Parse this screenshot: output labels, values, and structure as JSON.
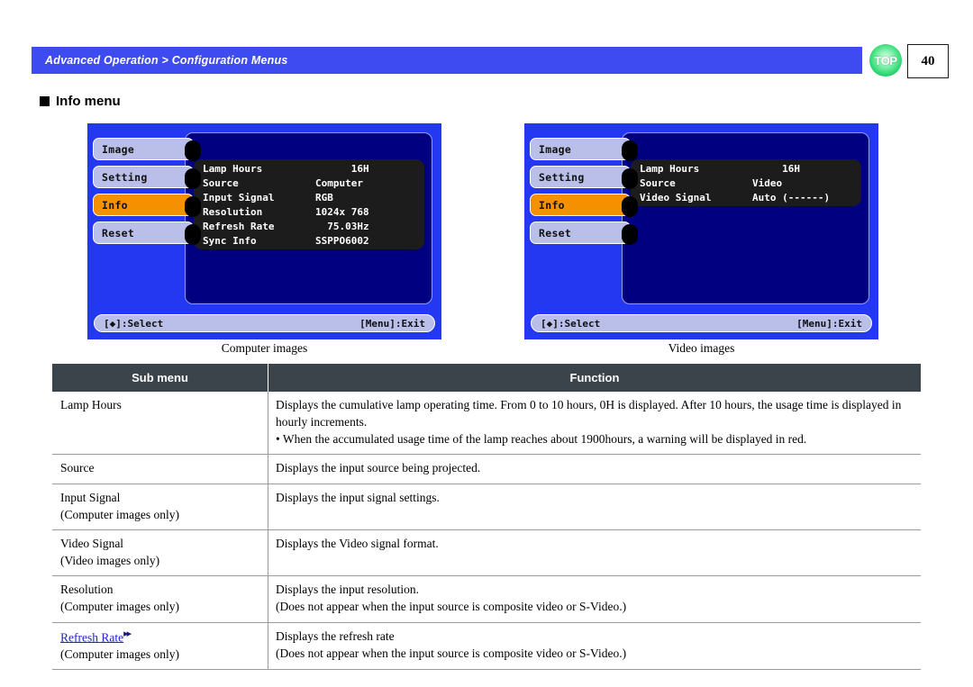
{
  "header": {
    "breadcrumb": "Advanced Operation > Configuration Menus",
    "top_badge_label": "TOP",
    "page_number": "40",
    "bar_color": "#3d4bf0",
    "badge_color": "#3ee07e"
  },
  "section": {
    "heading": "Info menu"
  },
  "osd_screens": [
    {
      "caption": "Computer images",
      "tabs": [
        {
          "label": "Image",
          "selected": false
        },
        {
          "label": "Setting",
          "selected": false
        },
        {
          "label": "Info",
          "selected": true
        },
        {
          "label": "Reset",
          "selected": false
        }
      ],
      "rows": [
        {
          "label": "Lamp Hours",
          "value": "      16H"
        },
        {
          "label": "Source",
          "value": "Computer"
        },
        {
          "label": "Input Signal",
          "value": "RGB"
        },
        {
          "label": "Resolution",
          "value": "1024x 768"
        },
        {
          "label": "Refresh Rate",
          "value": "  75.03Hz"
        },
        {
          "label": "Sync Info",
          "value": "SSPPO6002"
        }
      ],
      "footer_left": "[◆]:Select",
      "footer_right": "[Menu]:Exit"
    },
    {
      "caption": "Video images",
      "tabs": [
        {
          "label": "Image",
          "selected": false
        },
        {
          "label": "Setting",
          "selected": false
        },
        {
          "label": "Info",
          "selected": true
        },
        {
          "label": "Reset",
          "selected": false
        }
      ],
      "rows": [
        {
          "label": "Lamp Hours",
          "value": "     16H"
        },
        {
          "label": "Source",
          "value": "Video"
        },
        {
          "label": "Video Signal",
          "value": "Auto (------)"
        }
      ],
      "footer_left": "[◆]:Select",
      "footer_right": "[Menu]:Exit"
    }
  ],
  "table": {
    "headers": {
      "sub_menu": "Sub menu",
      "function": "Function"
    },
    "rows": [
      {
        "sub_menu": "Lamp Hours",
        "sub_note": "",
        "function_lines": [
          "Displays the cumulative lamp operating time. From 0 to 10 hours, 0H is displayed. After 10 hours, the usage time is displayed in hourly increments.",
          "• When the accumulated usage time of the lamp reaches about 1900hours, a warning will be displayed in red."
        ]
      },
      {
        "sub_menu": "Source",
        "sub_note": "",
        "function_lines": [
          "Displays the input source being projected."
        ]
      },
      {
        "sub_menu": "Input Signal",
        "sub_note": "(Computer images only)",
        "function_lines": [
          "Displays the input signal settings."
        ]
      },
      {
        "sub_menu": "Video Signal",
        "sub_note": "(Video images only)",
        "function_lines": [
          "Displays the Video signal format."
        ]
      },
      {
        "sub_menu": "Resolution",
        "sub_note": "(Computer images only)",
        "function_lines": [
          "Displays the input resolution.",
          "(Does not appear when  the input source is composite video or S-Video.)"
        ]
      },
      {
        "sub_menu": "Refresh Rate",
        "sub_menu_is_link": true,
        "sub_note": "(Computer images only)",
        "function_lines": [
          "Displays the refresh rate",
          "(Does not appear when  the input source is composite video or S-Video.)"
        ]
      }
    ]
  }
}
